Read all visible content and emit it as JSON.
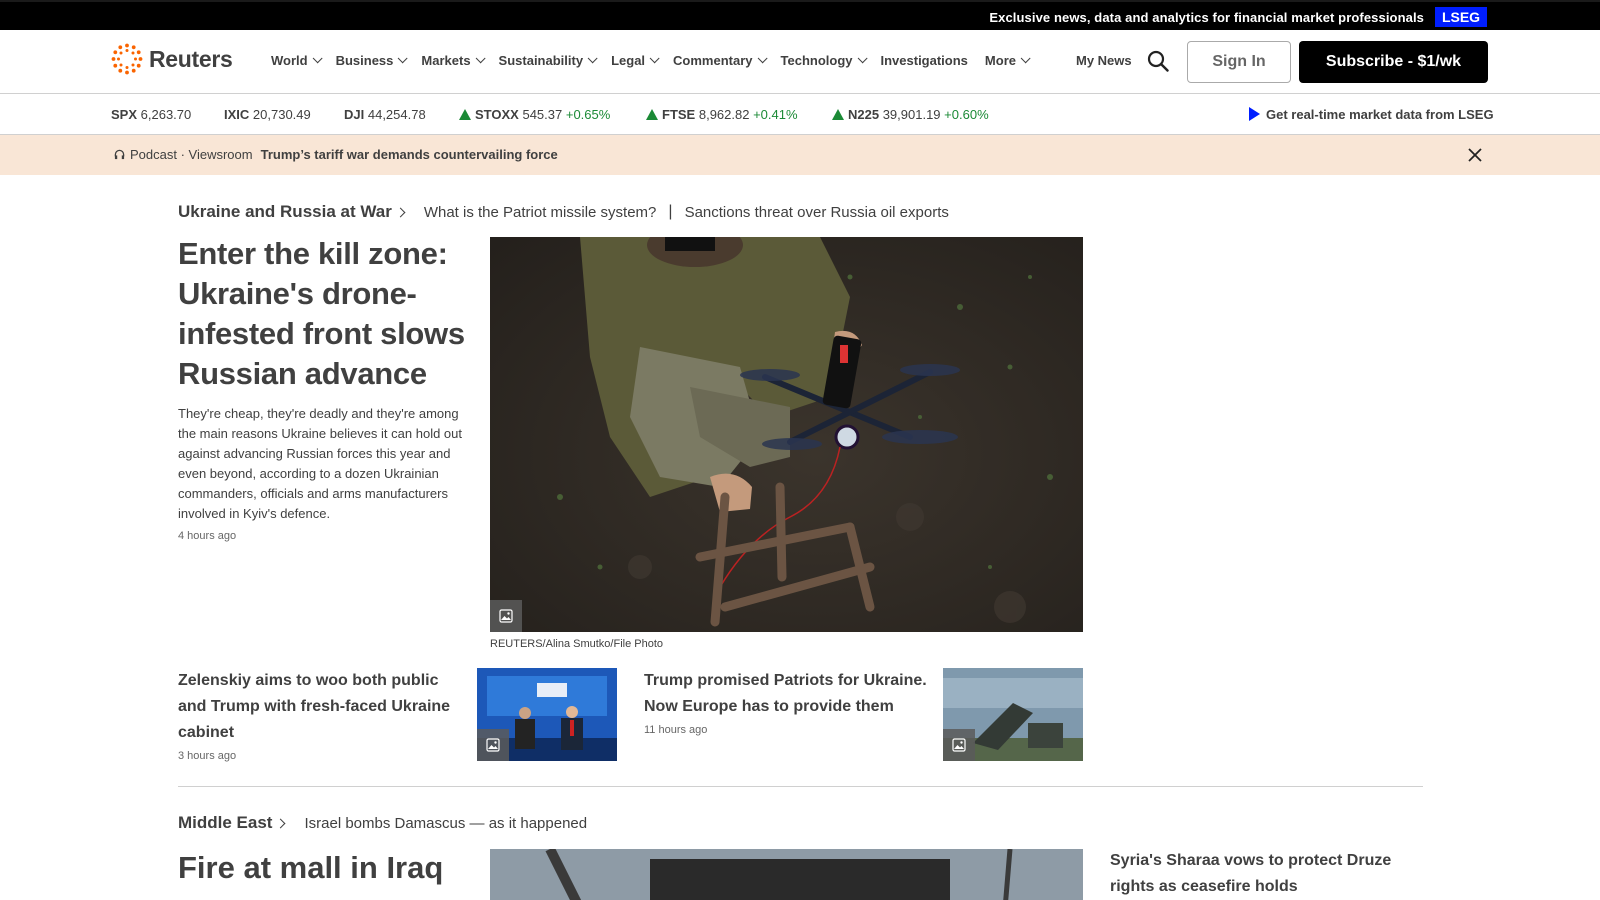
{
  "topbar": {
    "promo": "Exclusive news, data and analytics for financial market professionals",
    "badge": "LSEG"
  },
  "header": {
    "logo_text": "Reuters",
    "nav": [
      {
        "label": "World",
        "has_menu": true
      },
      {
        "label": "Business",
        "has_menu": true
      },
      {
        "label": "Markets",
        "has_menu": true
      },
      {
        "label": "Sustainability",
        "has_menu": true
      },
      {
        "label": "Legal",
        "has_menu": true
      },
      {
        "label": "Commentary",
        "has_menu": true
      },
      {
        "label": "Technology",
        "has_menu": true
      },
      {
        "label": "Investigations",
        "has_menu": false
      },
      {
        "label": "More",
        "has_menu": true
      }
    ],
    "my_news": "My News",
    "sign_in": "Sign In",
    "subscribe": "Subscribe - $1/wk"
  },
  "ticker": {
    "items": [
      {
        "symbol": "SPX",
        "value": "6,263.70",
        "change": "",
        "up": false
      },
      {
        "symbol": "IXIC",
        "value": "20,730.49",
        "change": "",
        "up": false
      },
      {
        "symbol": "DJI",
        "value": "44,254.78",
        "change": "",
        "up": false
      },
      {
        "symbol": "STOXX",
        "value": "545.37",
        "change": "+0.65%",
        "up": true
      },
      {
        "symbol": "FTSE",
        "value": "8,962.82",
        "change": "+0.41%",
        "up": true
      },
      {
        "symbol": "N225",
        "value": "39,901.19",
        "change": "+0.60%",
        "up": true
      }
    ],
    "lseg_link": "Get real-time market data from LSEG",
    "up_color": "#1b8a36"
  },
  "banner": {
    "label": "Podcast · Viewsroom",
    "headline": "Trump’s tariff war demands countervailing force"
  },
  "section1": {
    "title": "Ukraine and Russia at War",
    "links": [
      "What is the Patriot missile system?",
      "Sanctions threat over Russia oil exports"
    ],
    "lead": {
      "headline": "Enter the kill zone: Ukraine's drone-infested front slows Russian advance",
      "description": "They're cheap, they're deadly and they're among the main reasons Ukraine believes it can hold out against advancing Russian forces this year and even beyond, according to a dozen Ukrainian commanders, officials and arms manufacturers involved in Kyiv's defence.",
      "time": "4 hours ago",
      "caption": "REUTERS/Alina Smutko/File Photo"
    },
    "stories": [
      {
        "headline": "Zelenskiy aims to woo both public and Trump with fresh-faced Ukraine cabinet",
        "time": "3 hours ago"
      },
      {
        "headline": "Trump promised Patriots for Ukraine. Now Europe has to provide them",
        "time": "11 hours ago"
      }
    ]
  },
  "section2": {
    "title": "Middle East",
    "links": [
      "Israel bombs Damascus — as it happened"
    ],
    "lead_headline": "Fire at mall in Iraq",
    "side_headline": "Syria's Sharaa vows to protect Druze rights as ceasefire holds"
  }
}
